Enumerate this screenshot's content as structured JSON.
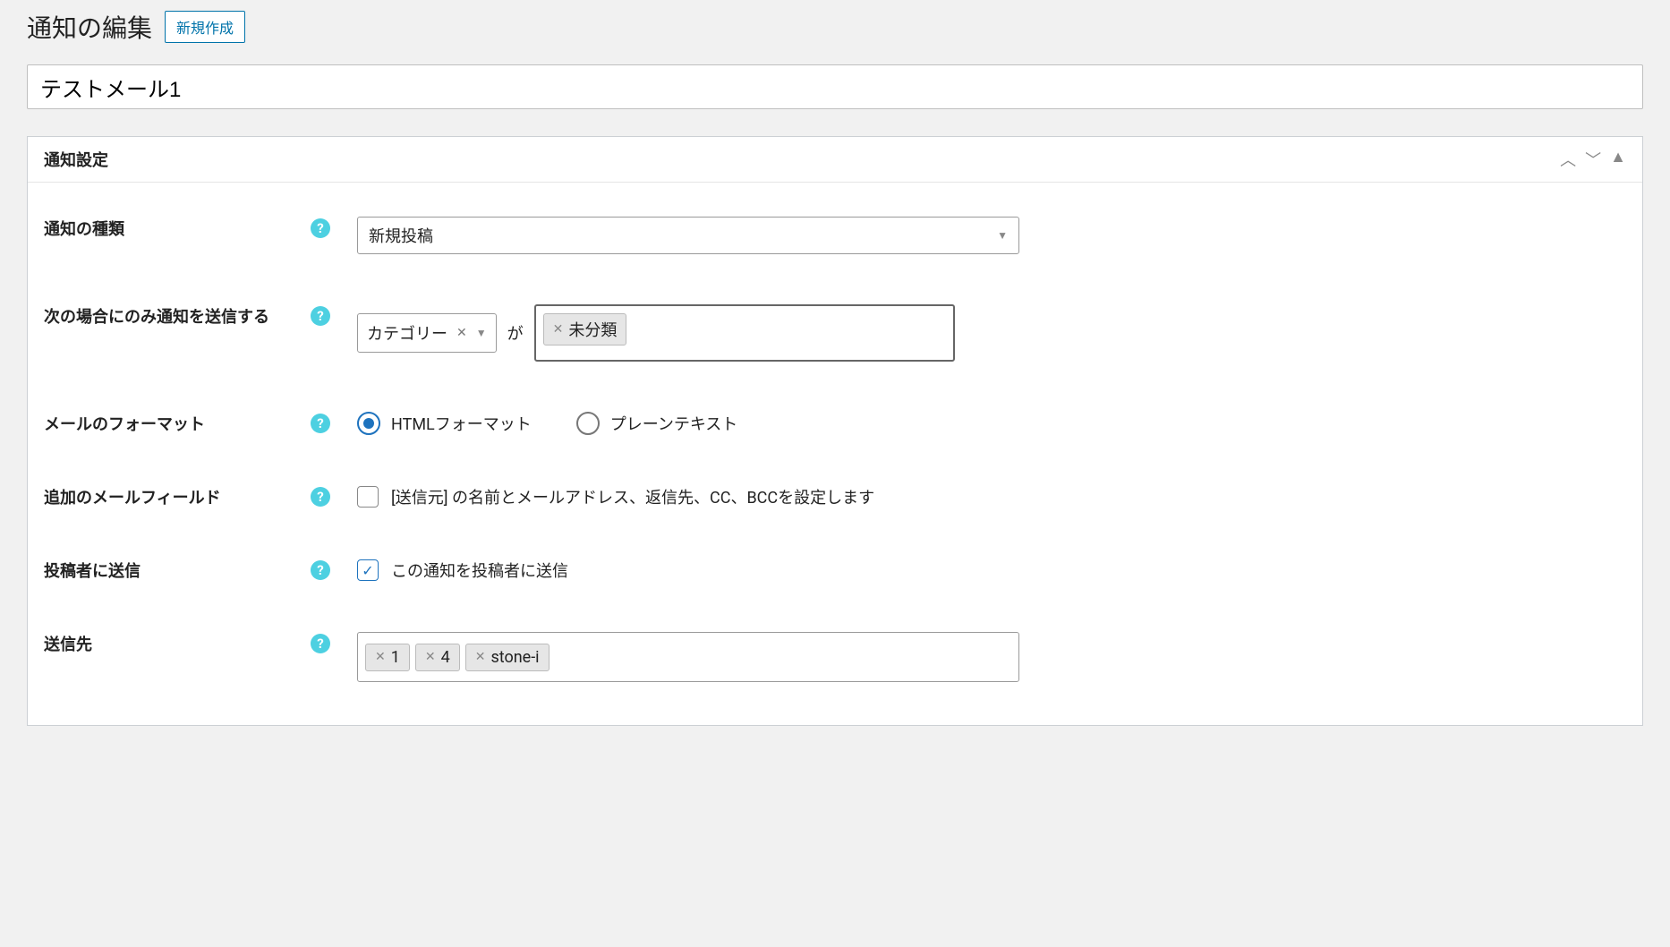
{
  "header": {
    "page_title": "通知の編集",
    "new_button": "新規作成"
  },
  "title_input": {
    "value": "テストメール1"
  },
  "metabox": {
    "title": "通知設定"
  },
  "fields": {
    "type": {
      "label": "通知の種類",
      "value": "新規投稿"
    },
    "condition": {
      "label": "次の場合にのみ通知を送信する",
      "filter": "カテゴリー",
      "connector": "が",
      "tags": [
        "未分類"
      ]
    },
    "format": {
      "label": "メールのフォーマット",
      "options": {
        "html": "HTMLフォーマット",
        "plain": "プレーンテキスト"
      },
      "selected": "html"
    },
    "additional": {
      "label": "追加のメールフィールド",
      "checkbox_label": "[送信元] の名前とメールアドレス、返信先、CC、BCCを設定します",
      "checked": false
    },
    "send_author": {
      "label": "投稿者に送信",
      "checkbox_label": "この通知を投稿者に送信",
      "checked": true
    },
    "recipients": {
      "label": "送信先",
      "tags": [
        "1",
        "4",
        "stone-i"
      ]
    }
  }
}
